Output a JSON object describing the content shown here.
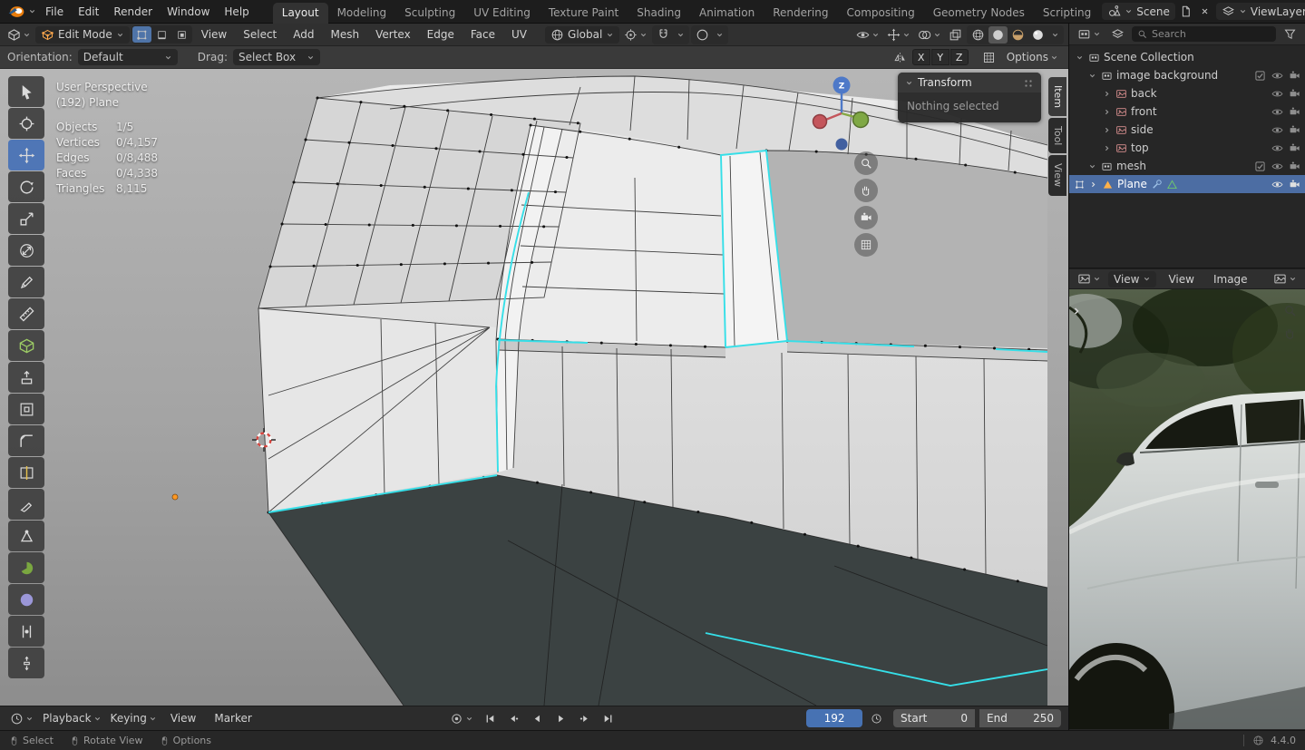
{
  "topbar": {
    "menus": [
      "File",
      "Edit",
      "Render",
      "Window",
      "Help"
    ],
    "workspaces": [
      "Layout",
      "Modeling",
      "Sculpting",
      "UV Editing",
      "Texture Paint",
      "Shading",
      "Animation",
      "Rendering",
      "Compositing",
      "Geometry Nodes",
      "Scripting"
    ],
    "active_workspace": "Layout",
    "scene_name": "Scene",
    "viewlayer_name": "ViewLayer"
  },
  "viewport": {
    "header": {
      "mode": "Edit Mode",
      "menus": [
        "View",
        "Select",
        "Add",
        "Mesh",
        "Vertex",
        "Edge",
        "Face",
        "UV"
      ],
      "orientation": "Global"
    },
    "tool_settings": {
      "orientation_label": "Orientation:",
      "orientation_value": "Default",
      "drag_label": "Drag:",
      "drag_value": "Select Box",
      "mirror_x": "X",
      "mirror_y": "Y",
      "mirror_z": "Z",
      "options_label": "Options"
    },
    "overlay": {
      "view_name": "User Perspective",
      "object_name": "(192) Plane",
      "stats": [
        {
          "label": "Objects",
          "value": "1/5"
        },
        {
          "label": "Vertices",
          "value": "0/4,157"
        },
        {
          "label": "Edges",
          "value": "0/8,488"
        },
        {
          "label": "Faces",
          "value": "0/4,338"
        },
        {
          "label": "Triangles",
          "value": "8,115"
        }
      ]
    },
    "axis_gizmo_label": "Z",
    "side_tabs": [
      "Item",
      "Tool",
      "View"
    ],
    "transform_panel": {
      "title": "Transform",
      "message": "Nothing selected"
    }
  },
  "outliner": {
    "search_placeholder": "Search",
    "tree": [
      {
        "label": "Scene Collection"
      },
      {
        "label": "image background"
      },
      {
        "label": "back"
      },
      {
        "label": "front"
      },
      {
        "label": "side"
      },
      {
        "label": "top"
      },
      {
        "label": "mesh"
      },
      {
        "label": "Plane"
      }
    ]
  },
  "image_editor": {
    "display_mode": "View",
    "menus": [
      "View",
      "Image"
    ]
  },
  "timeline": {
    "menus": [
      "Playback",
      "Keying",
      "View",
      "Marker"
    ],
    "current_frame": "192",
    "start_label": "Start",
    "start_value": "0",
    "end_label": "End",
    "end_value": "250"
  },
  "statusbar": {
    "hints": [
      "Select",
      "Rotate View",
      "Options"
    ],
    "version": "4.4.0"
  },
  "colors": {
    "accent_blue": "#4772b3",
    "active_tool_blue": "#4f76b6",
    "edge_highlight_cyan": "#35dfe8",
    "selected_row_blue": "#4c6da3",
    "floor_gray": "#3b4242",
    "axis_z_blue": "#4e79c8",
    "axis_x_red": "#c4565c",
    "axis_y_green": "#7fa845"
  },
  "icons": {
    "search": "magnifier",
    "filter": "funnel",
    "visibility": "eye",
    "render_visibility": "camera",
    "snapping": "magnet",
    "proportional_editing": "circle",
    "transport": [
      "jump-to-start",
      "jump-to-prev-keyframe",
      "play-reverse",
      "play",
      "jump-to-next-keyframe",
      "jump-to-end"
    ]
  }
}
